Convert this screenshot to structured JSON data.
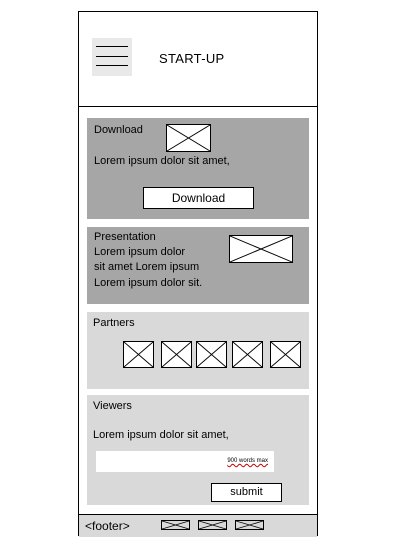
{
  "header": {
    "brand": "START-UP",
    "menu_icon": "hamburger-menu-icon"
  },
  "download": {
    "title": "Download",
    "text": "Lorem ipsum dolor sit amet,",
    "button": "Download",
    "image_icon": "image-placeholder-icon"
  },
  "presentation": {
    "title": "Presentation",
    "lines": [
      "Lorem ipsum dolor",
      "sit amet Lorem ipsum",
      "Lorem ipsum dolor sit."
    ],
    "image_icon": "image-placeholder-icon"
  },
  "partners": {
    "title": "Partners",
    "logo_icon": "image-placeholder-icon",
    "count": 5
  },
  "viewers": {
    "title": "Viewers",
    "text": "Lorem ipsum dolor sit amet,",
    "field_hint": "900 words max",
    "submit": "submit"
  },
  "footer": {
    "label": "<footer>",
    "icon": "image-placeholder-icon"
  },
  "colors": {
    "dark_section": "#a6a6a6",
    "light_section": "#d9d9d9",
    "header_menu_bg": "#e9e9e9"
  }
}
